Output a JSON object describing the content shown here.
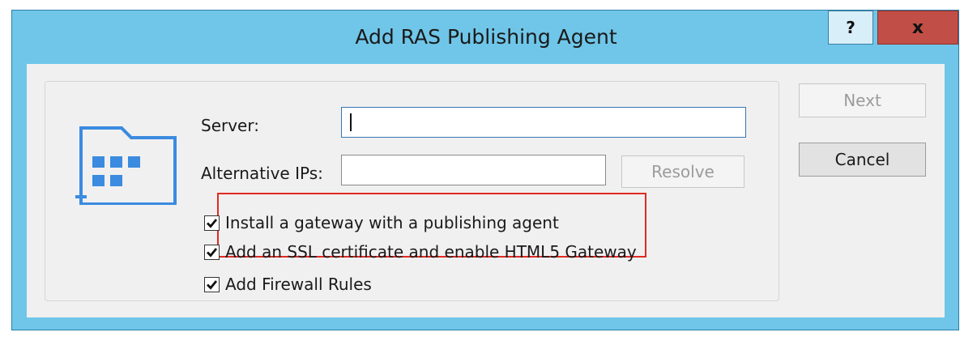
{
  "window": {
    "title": "Add RAS Publishing Agent",
    "help_label": "?",
    "close_label": "x"
  },
  "form": {
    "server_label": "Server:",
    "server_value": "",
    "alt_ips_label": "Alternative IPs:",
    "alt_ips_value": "",
    "resolve_label": "Resolve"
  },
  "options": [
    {
      "label": "Install a gateway with a publishing agent",
      "checked": true
    },
    {
      "label": "Add an SSL certificate and enable HTML5 Gateway",
      "checked": true
    },
    {
      "label": "Add Firewall Rules",
      "checked": true
    }
  ],
  "actions": {
    "next_label": "Next",
    "cancel_label": "Cancel"
  },
  "colors": {
    "accent": "#3b8be0",
    "title_bar": "#6fc6e8",
    "close_button": "#c24f47",
    "highlight": "#e02a20"
  }
}
